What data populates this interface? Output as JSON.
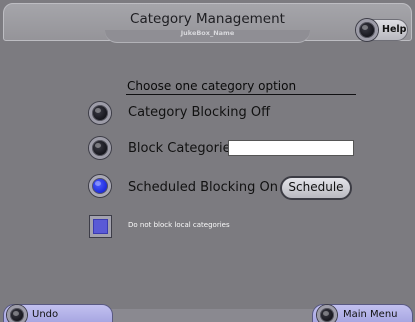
{
  "header": {
    "title": "Category Management",
    "subtitle": "JukeBox_Name",
    "help_label": "Help"
  },
  "options": {
    "heading": "Choose one category option",
    "items": [
      {
        "label": "Category Blocking Off",
        "selected": false
      },
      {
        "label": "Block Categories",
        "selected": false,
        "input_value": ""
      },
      {
        "label": "Scheduled Blocking On",
        "selected": true,
        "button_label": "Schedule"
      }
    ],
    "local_checkbox_label": "Do not block local categories"
  },
  "footer": {
    "undo_label": "Undo",
    "main_menu_label": "Main Menu"
  },
  "colors": {
    "background": "#7c7b80",
    "selected_radio": "#2233ee",
    "footer_button": "#b0aff0"
  },
  "icons": [
    "knob-icon",
    "checkbox-icon"
  ]
}
